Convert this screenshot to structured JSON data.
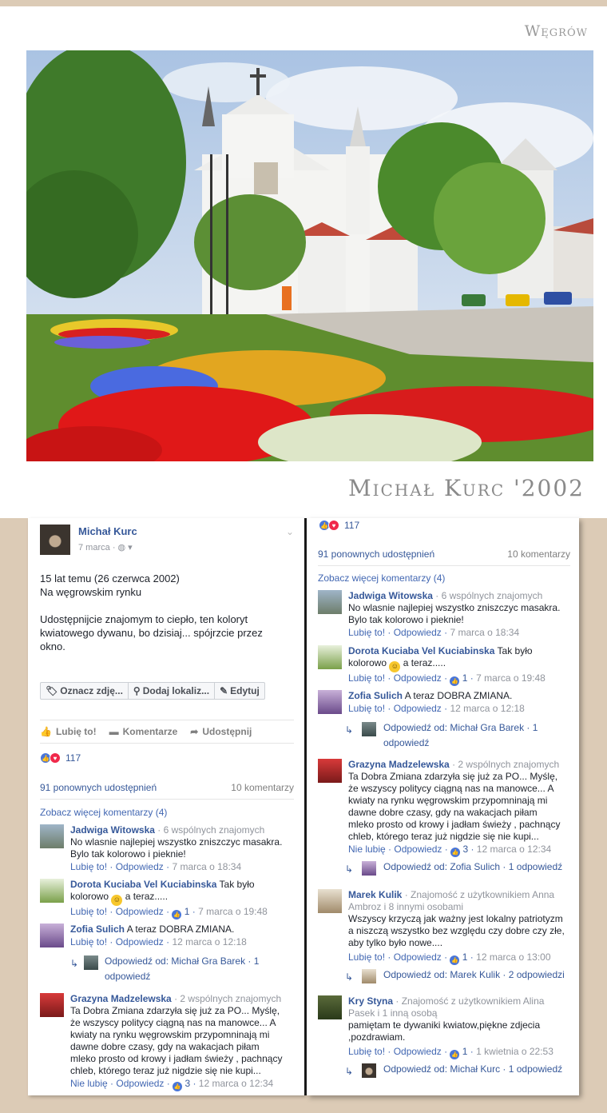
{
  "header": {
    "city": "Węgrów",
    "signature": "Michał Kurc '2002"
  },
  "post": {
    "author": "Michał Kurc",
    "date": "7 marca",
    "text_line1": "15 lat temu (26 czerwca 2002)",
    "text_line2": "Na węgrowskim rynku",
    "text_para2": "Udostępnijcie znajomym to ciepło, ten koloryt kwiatowego dywanu, bo dzisiaj... spójrzcie przez okno.",
    "tag_photo": "Oznacz zdję...",
    "add_location": "Dodaj lokaliz...",
    "edit": "Edytuj",
    "like": "Lubię to!",
    "comment": "Komentarze",
    "share": "Udostępnij",
    "reactions_count": "117",
    "shares": "91 ponownych udostępnień",
    "comments_count": "10 komentarzy",
    "more_comments": "Zobacz więcej komentarzy (4)"
  },
  "comments": {
    "c1": {
      "name": "Jadwiga Witowska",
      "mutual": " · 6 wspólnych znajomych",
      "text": "No wlasnie najlepiej wszystko zniszczyc masakra. Bylo tak kolorowo i pieknie!",
      "like": "Lubię to!",
      "reply": "Odpowiedz",
      "time": "7 marca o 18:34"
    },
    "c2": {
      "name": "Dorota Kuciaba Vel Kuciabinska",
      "text_a": " Tak było kolorowo ",
      "text_b": " a teraz.....",
      "like": "Lubię to!",
      "reply": "Odpowiedz",
      "likes": "1",
      "time": "7 marca o 19:48"
    },
    "c3": {
      "name": "Zofia Sulich",
      "text": " A teraz DOBRA ZMIANA.",
      "like": "Lubię to!",
      "reply": "Odpowiedz",
      "time": "12 marca o 12:18",
      "reply_from": "Odpowiedź od: Michał Gra Barek",
      "reply_count": "1 odpowiedź"
    },
    "c4": {
      "name": "Grazyna Madzelewska",
      "mutual": " · 2 wspólnych znajomych",
      "text": "Ta Dobra Zmiana zdarzyła się już za PO... Myślę, że wszyscy politycy ciągną nas na manowce... A kwiaty na rynku węgrowskim przypomninają mi dawne dobre czasy, gdy na wakacjach piłam mleko prosto od krowy i jadłam świeży , pachnący chleb, którego teraz już nigdzie się nie kupi...",
      "like": "Nie lubię",
      "reply": "Odpowiedz",
      "likes": "3",
      "time": "12 marca o 12:34",
      "reply_from": "Odpowiedź od: Zofia Sulich",
      "reply_count": "1 odpowiedź"
    },
    "c5": {
      "name": "Marek Kulik",
      "mutual": " · Znajomość z użytkownikiem Anna Ambroz i 8 innymi osobami",
      "text": "Wszyscy krzyczą jak ważny jest lokalny patriotyzm a niszczą wszystko bez względu czy dobre czy złe, aby tylko było nowe....",
      "like": "Lubię to!",
      "reply": "Odpowiedz",
      "likes": "1",
      "time": "12 marca o 13:00",
      "reply_from": "Odpowiedź od: Marek Kulik",
      "reply_count": "2 odpowiedzi"
    },
    "c6": {
      "name": "Kry Styna",
      "mutual": " · Znajomość z użytkownikiem Alina Pasek i 1 inną osobą",
      "text": "pamiętam te dywaniki kwiatow,piękne zdjecia ,pozdrawiam.",
      "like": "Lubię to!",
      "reply": "Odpowiedz",
      "likes": "1",
      "time": "1 kwietnia o 22:53",
      "reply_from": "Odpowiedź od: Michał Kurc",
      "reply_count": "1 odpowiedź"
    }
  }
}
